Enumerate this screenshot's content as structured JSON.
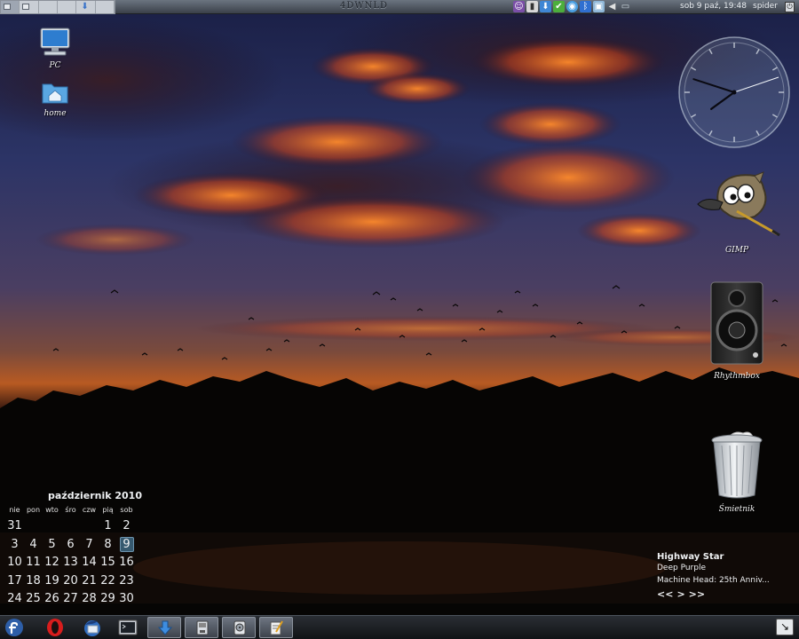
{
  "top_panel": {
    "title": "4DWNLD",
    "clock": "sob  9 paź, 19:48",
    "user": "spider",
    "tray_icons": [
      "pidgin-icon",
      "usb-icon",
      "download-icon",
      "update-icon",
      "network-icon",
      "bluetooth-icon",
      "screenshot-icon",
      "volume-icon",
      "display-icon"
    ]
  },
  "desktop": {
    "icons": [
      {
        "label": "PC",
        "icon": "computer-icon"
      },
      {
        "label": "home",
        "icon": "home-folder-icon"
      },
      {
        "label": "GIMP",
        "icon": "gimp-icon"
      },
      {
        "label": "Rhythmbox",
        "icon": "speaker-icon"
      },
      {
        "label": "Śmietnik",
        "icon": "trash-icon"
      }
    ]
  },
  "analog_clock": {
    "hour": 7,
    "minute": 48
  },
  "calendar": {
    "title": "październik 2010",
    "weekdays": [
      "nie",
      "pon",
      "wto",
      "śro",
      "czw",
      "pią",
      "sob"
    ],
    "weeks": [
      [
        "31",
        "",
        "",
        "",
        "",
        "1",
        "2"
      ],
      [
        "3",
        "4",
        "5",
        "6",
        "7",
        "8",
        "9"
      ],
      [
        "10",
        "11",
        "12",
        "13",
        "14",
        "15",
        "16"
      ],
      [
        "17",
        "18",
        "19",
        "20",
        "21",
        "22",
        "23"
      ],
      [
        "24",
        "25",
        "26",
        "27",
        "28",
        "29",
        "30"
      ]
    ],
    "today": "9"
  },
  "music": {
    "song": "Highway Star",
    "artist": "Deep Purple",
    "album": "Machine Head: 25th Anniv...",
    "prev": "<<",
    "play": ">",
    "next": ">>"
  },
  "bottom_panel": {
    "launchers": [
      "fedora-icon",
      "opera-icon",
      "thunderbird-icon",
      "terminal-icon"
    ],
    "tasks": [
      "download-manager-icon",
      "file-manager-icon",
      "disk-utility-icon",
      "text-editor-icon"
    ]
  },
  "colors": {
    "panel": "#3a4049",
    "accent": "#36596f"
  }
}
